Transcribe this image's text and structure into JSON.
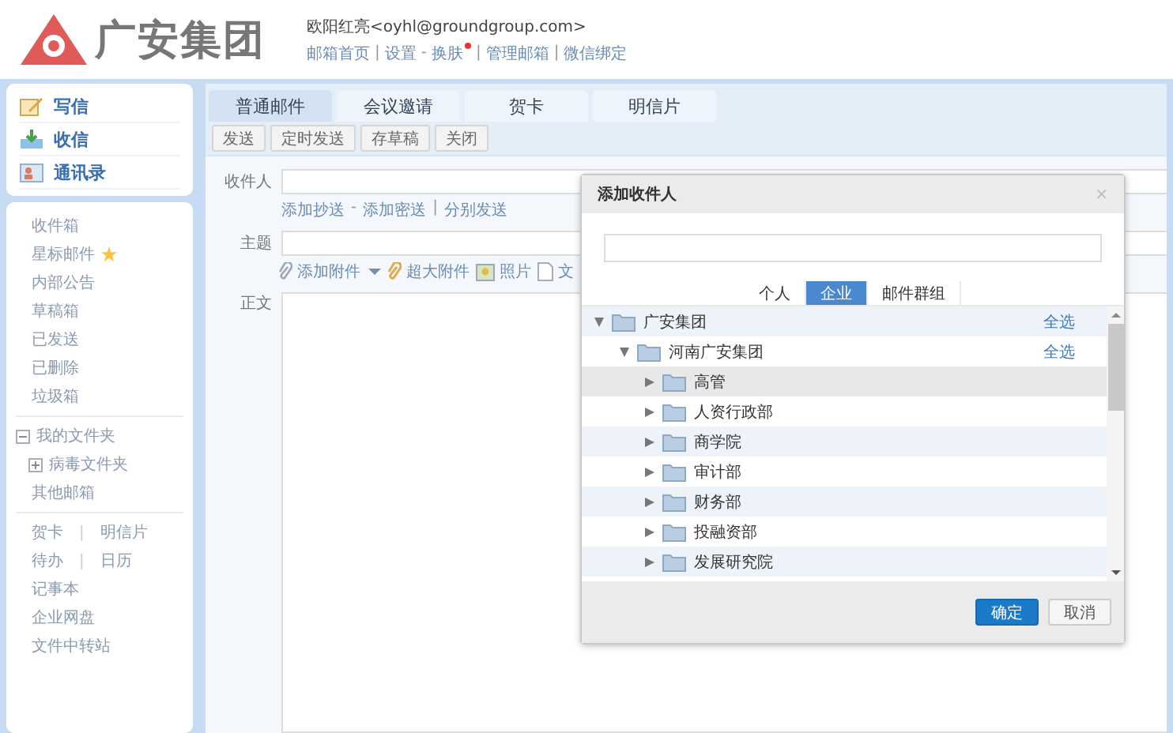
{
  "header": {
    "logo_text": "广安集团",
    "user": "欧阳红亮<oyhl@groundgroup.com>",
    "links": [
      {
        "label": "邮箱首页",
        "sep": "|"
      },
      {
        "label": "设置",
        "sep": "-"
      },
      {
        "label": "换肤",
        "sep": "|",
        "dot": true
      },
      {
        "label": "管理邮箱",
        "sep": "|"
      },
      {
        "label": "微信绑定"
      }
    ]
  },
  "sidebar": {
    "actions": [
      {
        "label": "写信",
        "kind": "write"
      },
      {
        "label": "收信",
        "kind": "receive"
      },
      {
        "label": "通讯录",
        "kind": "contacts"
      }
    ],
    "groups": [
      [
        {
          "label": "收件箱"
        },
        {
          "label": "星标邮件",
          "star": true
        },
        {
          "label": "内部公告"
        },
        {
          "label": "草稿箱"
        },
        {
          "label": "已发送"
        },
        {
          "label": "已删除"
        },
        {
          "label": "垃圾箱"
        }
      ],
      [
        {
          "label": "我的文件夹",
          "expanded": true,
          "children": [
            {
              "label": "病毒文件夹",
              "expanded": false
            }
          ]
        },
        {
          "label": "其他邮箱"
        }
      ],
      [
        {
          "label": "贺卡",
          "sep": "|",
          "label2": "明信片"
        },
        {
          "label": "待办",
          "sep": "|",
          "label2": "日历"
        },
        {
          "label": "记事本"
        },
        {
          "label": "企业网盘"
        },
        {
          "label": "文件中转站"
        }
      ]
    ]
  },
  "tabs": [
    {
      "label": "普通邮件",
      "selected": true
    },
    {
      "label": "会议邀请",
      "selected": false
    },
    {
      "label": "贺卡",
      "selected": false
    },
    {
      "label": "明信片",
      "selected": false
    }
  ],
  "toolbar": [
    "发送",
    "定时发送",
    "存草稿",
    "关闭"
  ],
  "form": {
    "to_label": "收件人",
    "cc_links": [
      {
        "label": "添加抄送",
        "sep": "-"
      },
      {
        "label": "添加密送",
        "sep": "|"
      },
      {
        "label": "分别发送"
      }
    ],
    "subject_label": "主题",
    "attach": [
      {
        "label": "添加附件",
        "kind": "clip"
      },
      {
        "label": "超大附件",
        "kind": "bigclip"
      },
      {
        "label": "照片",
        "kind": "photo"
      },
      {
        "label": "文",
        "kind": "doc"
      }
    ],
    "body_label": "正文"
  },
  "dialog": {
    "title": "添加收件人",
    "close": "×",
    "tabs": [
      {
        "label": "个人",
        "selected": false
      },
      {
        "label": "企业",
        "selected": true
      },
      {
        "label": "邮件群组",
        "selected": false
      }
    ],
    "tree": [
      {
        "label": "广安集团",
        "expanded": true,
        "action": "全选",
        "children": [
          {
            "label": "河南广安集团",
            "expanded": true,
            "action": "全选",
            "children": [
              {
                "label": "高管",
                "expanded": false,
                "selected": true
              },
              {
                "label": "人资行政部",
                "expanded": false,
                "selected": false
              },
              {
                "label": "商学院",
                "expanded": false,
                "selected": false
              },
              {
                "label": "审计部",
                "expanded": false,
                "selected": false
              },
              {
                "label": "财务部",
                "expanded": false,
                "selected": false
              },
              {
                "label": "投融资部",
                "expanded": false,
                "selected": false
              },
              {
                "label": "发展研究院",
                "expanded": false,
                "selected": false
              }
            ]
          }
        ]
      }
    ],
    "buttons": [
      {
        "label": "确定",
        "kind": "primary"
      },
      {
        "label": "取消",
        "kind": "secondary"
      }
    ]
  }
}
